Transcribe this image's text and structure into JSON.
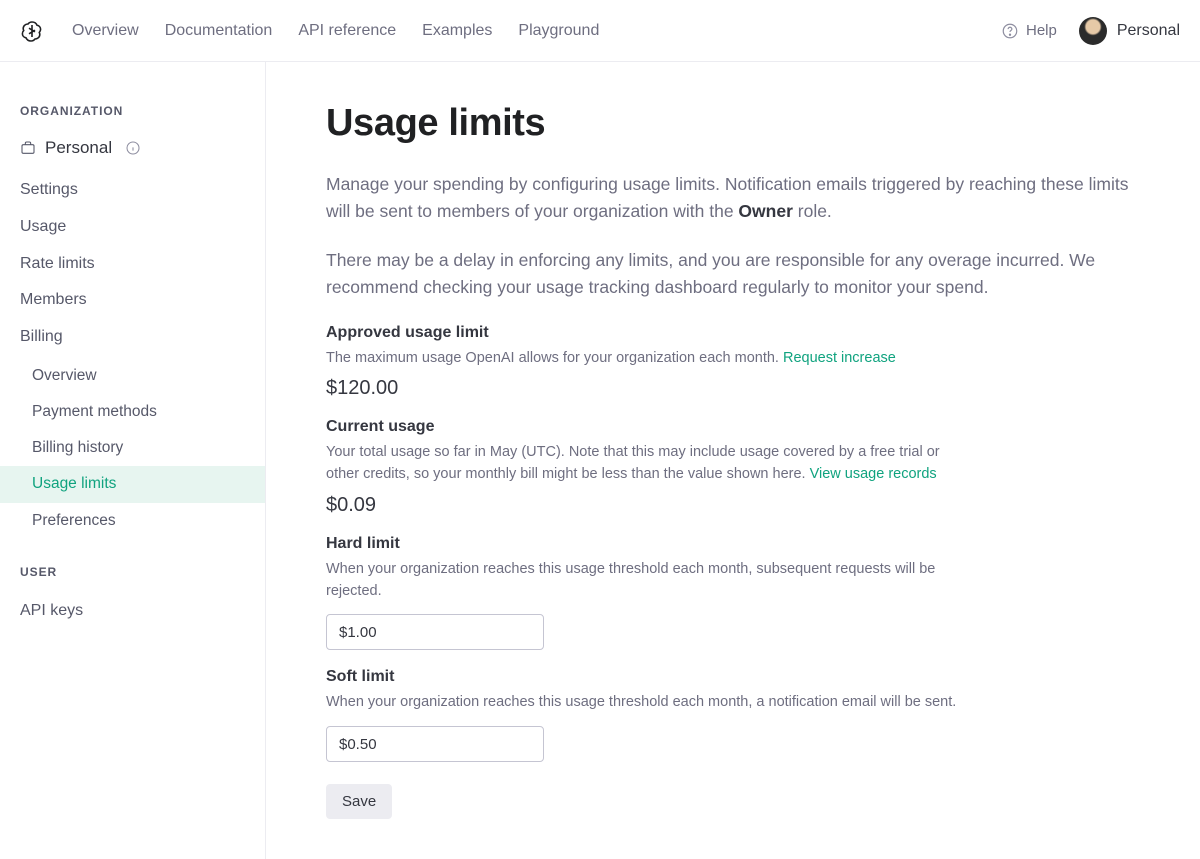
{
  "topnav": {
    "items": [
      "Overview",
      "Documentation",
      "API reference",
      "Examples",
      "Playground"
    ]
  },
  "topright": {
    "help": "Help",
    "account": "Personal"
  },
  "sidebar": {
    "org_header": "ORGANIZATION",
    "org_name": "Personal",
    "items": [
      "Settings",
      "Usage",
      "Rate limits",
      "Members",
      "Billing"
    ],
    "billing_sub": [
      "Overview",
      "Payment methods",
      "Billing history",
      "Usage limits",
      "Preferences"
    ],
    "active_sub": "Usage limits",
    "user_header": "USER",
    "user_items": [
      "API keys"
    ]
  },
  "page": {
    "title": "Usage limits",
    "intro1a": "Manage your spending by configuring usage limits. Notification emails triggered by reaching these limits will be sent to members of your organization with the ",
    "intro1_role": "Owner",
    "intro1b": " role.",
    "intro2": "There may be a delay in enforcing any limits, and you are responsible for any overage incurred. We recommend checking your usage tracking dashboard regularly to monitor your spend."
  },
  "approved": {
    "title": "Approved usage limit",
    "desc": "The maximum usage OpenAI allows for your organization each month. ",
    "link": "Request increase",
    "value": "$120.00"
  },
  "current": {
    "title": "Current usage",
    "desc": "Your total usage so far in May (UTC). Note that this may include usage covered by a free trial or other credits, so your monthly bill might be less than the value shown here. ",
    "link": "View usage records",
    "value": "$0.09"
  },
  "hard": {
    "title": "Hard limit",
    "desc": "When your organization reaches this usage threshold each month, subsequent requests will be rejected.",
    "value": "$1.00"
  },
  "soft": {
    "title": "Soft limit",
    "desc": "When your organization reaches this usage threshold each month, a notification email will be sent.",
    "value": "$0.50"
  },
  "save": "Save"
}
